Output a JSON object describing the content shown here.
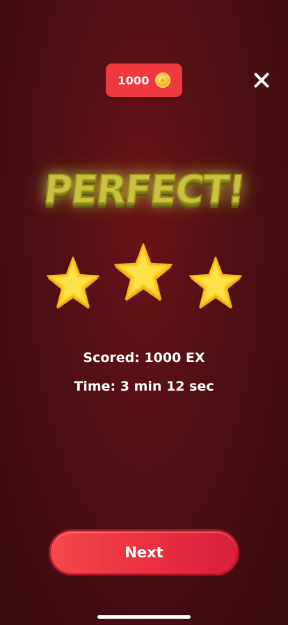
{
  "header": {
    "coins": "1000",
    "coin_icon": "coin-icon",
    "close_icon": "close-icon"
  },
  "result": {
    "title": "PERFECT!",
    "stars_earned": 3,
    "stars_total": 3
  },
  "stats": {
    "score_text": "Scored: 1000 EX",
    "time_text": "Time: 3 min 12 sec"
  },
  "actions": {
    "next_label": "Next"
  },
  "colors": {
    "background": "#4e0f14",
    "accent": "#ef3a3d",
    "title_glow": "#c9c23e",
    "star_fill": "#ffd21f",
    "star_edge": "#e8a317"
  }
}
